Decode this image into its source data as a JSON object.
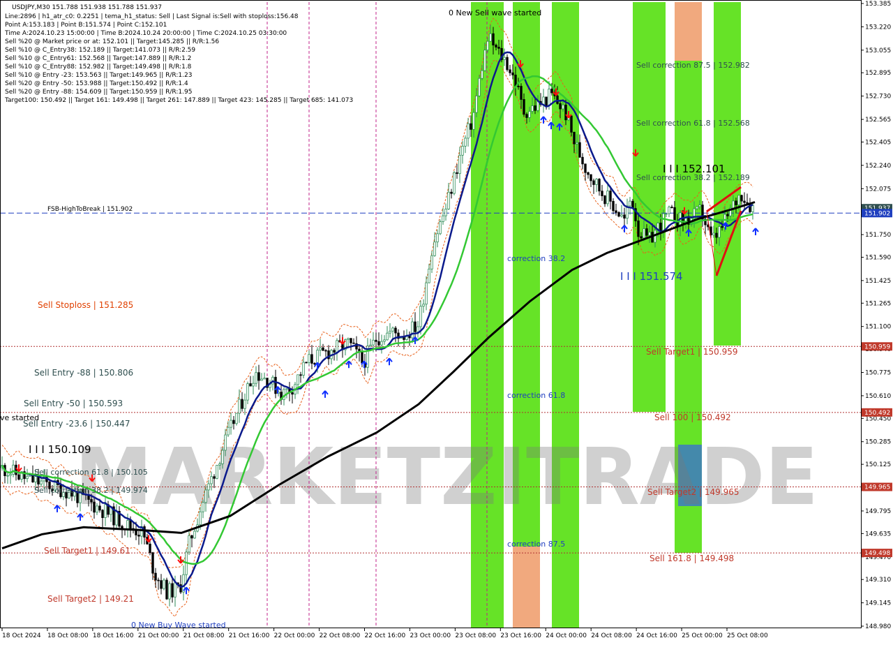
{
  "header": {
    "lines": [
      "USDJPY,M30   151.788 151.938 151.788 151.937",
      "Line:2896  |  h1_atr_c0: 0.2251  |  tema_h1_status: Sell  |  Last Signal is:Sell with stoploss:156.48",
      "Point A:153.183  |  Point B:151.574  |  Point C:152.101",
      "Time A:2024.10.23 15:00:00  |  Time B:2024.10.24 20:00:00  |  Time C:2024.10.25 03:30:00",
      "Sell %20 @ Market price or at: 152.101  ||  Target:145.285  ||  R/R:1.56",
      "Sell %10 @ C_Entry38: 152.189  ||  Target:141.073  ||  R/R:2.59",
      "Sell %10 @ C_Entry61: 152.568  ||  Target:147.889  ||  R/R:1.2",
      "Sell %10 @ C_Entry88: 152.982  ||  Target:149.498  ||  R/R:1.8",
      "Sell %10 @ Entry -23: 153.563  ||  Target:149.965  ||  R/R:1.23",
      "Sell %20 @ Entry -50: 153.988  ||  Target:150.492  ||  R/R:1.4",
      "Sell %20 @ Entry -88: 154.609  ||  Target:150.959  ||  R/R:1.95",
      "Target100: 150.492  ||  Target 161: 149.498  ||  Target 261: 147.889  ||  Target 423: 145.285  ||  Target 685: 141.073"
    ]
  },
  "chart_data": {
    "type": "candlestick",
    "symbol": "USDJPY",
    "timeframe": "M30",
    "ylim": [
      148.98,
      153.385
    ],
    "y_ticks": [
      "153.385",
      "153.220",
      "153.055",
      "152.895",
      "152.730",
      "152.565",
      "152.405",
      "152.240",
      "152.075",
      "151.915",
      "151.750",
      "151.590",
      "151.425",
      "151.265",
      "151.100",
      "150.940",
      "150.775",
      "150.610",
      "150.450",
      "150.285",
      "150.125",
      "149.960",
      "149.795",
      "149.635",
      "149.470",
      "149.310",
      "149.145",
      "148.980"
    ],
    "x_labels": [
      "18 Oct 2024",
      "18 Oct 08:00",
      "18 Oct 16:00",
      "21 Oct 00:00",
      "21 Oct 08:00",
      "21 Oct 16:00",
      "22 Oct 00:00",
      "22 Oct 08:00",
      "22 Oct 16:00",
      "23 Oct 00:00",
      "23 Oct 08:00",
      "23 Oct 16:00",
      "24 Oct 00:00",
      "24 Oct 08:00",
      "24 Oct 16:00",
      "25 Oct 00:00",
      "25 Oct 08:00"
    ],
    "price_axis_tags": [
      {
        "value": 151.937,
        "text": "151.937",
        "color": "#2f4f4f"
      },
      {
        "value": 151.902,
        "text": "151.902",
        "color": "#1f3fbf"
      },
      {
        "value": 150.959,
        "text": "150.959",
        "color": "#c0392b"
      },
      {
        "value": 150.492,
        "text": "150.492",
        "color": "#c0392b"
      },
      {
        "value": 149.965,
        "text": "149.965",
        "color": "#c0392b"
      },
      {
        "value": 149.498,
        "text": "149.498",
        "color": "#c0392b"
      }
    ],
    "hlines": [
      {
        "value": 151.902,
        "style": "dashed",
        "color": "#1f3fbf"
      },
      {
        "value": 150.959,
        "style": "dotted",
        "color": "#b03030"
      },
      {
        "value": 150.492,
        "style": "dotted",
        "color": "#b03030"
      },
      {
        "value": 149.965,
        "style": "dotted",
        "color": "#b03030"
      },
      {
        "value": 149.498,
        "style": "dotted",
        "color": "#b03030"
      }
    ],
    "annotations": [
      {
        "text": "0 New Sell wave started",
        "color": "#000000"
      },
      {
        "text": "FSB-HighToBreak  |  151.902",
        "color": "#000000"
      },
      {
        "text": "Sell Stoploss | 151.285",
        "color": "#e04000"
      },
      {
        "text": "Sell Entry -88 | 150.806",
        "color": "#2f4f4f"
      },
      {
        "text": "Sell Entry -50 | 150.593",
        "color": "#2f4f4f"
      },
      {
        "text": "Sell Entry -23.6 | 150.447",
        "color": "#2f4f4f"
      },
      {
        "text": "ve started",
        "color": "#000000"
      },
      {
        "text": "I I I 150.109",
        "color": "#000000"
      },
      {
        "text": "Sell correction 61.8 | 150.105",
        "color": "#2f4f4f"
      },
      {
        "text": "Sell correction 38.2 | 149.974",
        "color": "#2f4f4f"
      },
      {
        "text": "Sell Target1 | 149.61",
        "color": "#c0392b"
      },
      {
        "text": "Sell Target2 | 149.21",
        "color": "#c0392b"
      },
      {
        "text": "0 New Buy Wave started",
        "color": "#1f3fbf"
      },
      {
        "text": "correction 38.2",
        "color": "#1f3fbf"
      },
      {
        "text": "correction 61.8",
        "color": "#1f3fbf"
      },
      {
        "text": "correction 87.5",
        "color": "#1f3fbf"
      },
      {
        "text": "Sell correction 87.5 | 152.982",
        "color": "#2f4f4f"
      },
      {
        "text": "Sell correction 61.8 | 152.568",
        "color": "#2f4f4f"
      },
      {
        "text": "Sell correction 38.2 | 152.189",
        "color": "#2f4f4f"
      },
      {
        "text": "I I I 152.101",
        "color": "#000000"
      },
      {
        "text": "I I I 151.574",
        "color": "#1f3fbf"
      },
      {
        "text": "Sell Target1 | 150.959",
        "color": "#c0392b"
      },
      {
        "text": "Sell 100 | 150.492",
        "color": "#c0392b"
      },
      {
        "text": "Sell Target2 | 149.965",
        "color": "#c0392b"
      },
      {
        "text": "Sell 161.8 | 149.498",
        "color": "#c0392b"
      }
    ],
    "watermark": "MARKETZITRADE",
    "colors": {
      "bull": "#2e8b57",
      "bear": "#000000",
      "ma_navy": "#0b1a8c",
      "ma_green": "#33c833",
      "ma_black": "#000000",
      "band_orange": "#e8601a",
      "zone_green": "#55e010",
      "zone_orange": "#f0a070",
      "zone_blue": "#3a6bd8",
      "vline_magenta": "#c0208a"
    }
  }
}
